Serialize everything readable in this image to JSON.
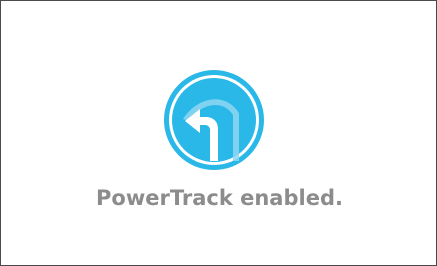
{
  "screen": {
    "message": "PowerTrack enabled.",
    "icon": "powertrack-left-turn-arrow-icon",
    "colors": {
      "accent": "#29b8e8",
      "accent_light": "#8fd6f2",
      "text": "#8c8c8c",
      "border": "#4a4a4a",
      "background": "#ffffff"
    }
  }
}
